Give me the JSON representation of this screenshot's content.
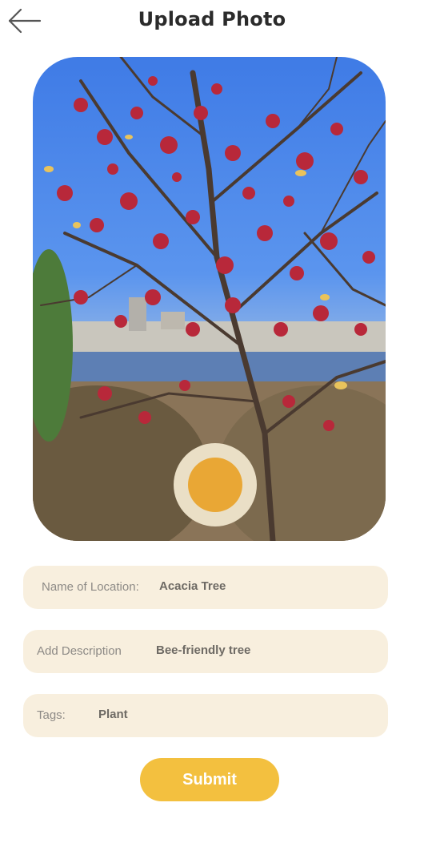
{
  "header": {
    "title": "Upload Photo",
    "back_icon": "arrow-left-icon"
  },
  "photo": {
    "description_icon": "camera-preview",
    "shutter_icon": "shutter-button-icon",
    "colors": {
      "ring": "#eadfc6",
      "core": "#e9a735"
    }
  },
  "form": {
    "location": {
      "label": "Name of Location:",
      "value": "Acacia Tree"
    },
    "description": {
      "label": "Add Description",
      "value": "Bee-friendly tree"
    },
    "tags": {
      "label": "Tags:",
      "value": "Plant"
    },
    "submit_label": "Submit"
  },
  "colors": {
    "field_bg": "#f8efde",
    "submit_bg": "#f3c03f",
    "title": "#2b2b2b"
  }
}
